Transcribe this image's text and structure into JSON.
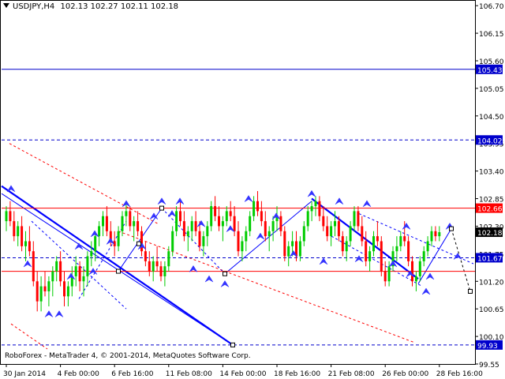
{
  "header": {
    "symbol": "USDJPY,H4",
    "open": "102.13",
    "high": "102.27",
    "low": "102.11",
    "close": "102.18"
  },
  "copyright": "RoboForex - MetaTrader 4, © 2001-2014, MetaQuotes Software Corp.",
  "colors": {
    "background": "#ffffff",
    "frame": "#000000",
    "bull_candle": "#00cc00",
    "bear_candle": "#ff0000",
    "level_line": "#0000cc",
    "resistance": "#ff0000",
    "label_blue": "#0000cc",
    "label_red": "#ff0000",
    "trend_channel": "#0000ff",
    "arrow_marker": "#3333ff"
  },
  "chart_data": {
    "type": "candlestick",
    "title": "USDJPY,H4",
    "ylim": [
      99.55,
      106.75
    ],
    "y_ticks": [
      "106.70",
      "106.15",
      "105.60",
      "105.05",
      "104.50",
      "103.95",
      "103.40",
      "102.85",
      "102.30",
      "101.75",
      "101.20",
      "100.65",
      "100.10",
      "99.55"
    ],
    "x_ticks": [
      "30 Jan 2014",
      "4 Feb 00:00",
      "6 Feb 16:00",
      "11 Feb 08:00",
      "14 Feb 00:00",
      "18 Feb 16:00",
      "21 Feb 08:00",
      "26 Feb 00:00",
      "28 Feb 16:00"
    ],
    "x_tick_index": [
      0,
      14,
      28,
      42,
      56,
      70,
      84,
      98,
      112
    ],
    "levels": [
      {
        "label": "105.43",
        "value": 105.43,
        "style": "solid",
        "color": "#0000cc",
        "label_bg": "#0000cc"
      },
      {
        "label": "104.02",
        "value": 104.02,
        "style": "dashed",
        "color": "#0000cc",
        "label_bg": "#0000cc"
      },
      {
        "label": "102.66",
        "value": 102.66,
        "style": "solid",
        "color": "#ff0000",
        "label_bg": "#ff0000"
      },
      {
        "label": "102.18",
        "value": 102.18,
        "style": "none",
        "color": "#000000",
        "label_bg": "#000000"
      },
      {
        "label": "101.67",
        "value": 101.67,
        "style": "dashed",
        "color": "#0000cc",
        "label_bg": "#0000cc"
      },
      {
        "label": "99.93",
        "value": 99.93,
        "style": "dashed",
        "color": "#0000cc",
        "label_bg": "#0000cc"
      }
    ],
    "resistance_line_2": 101.4,
    "candles": [
      [
        102.4,
        102.7,
        102.2,
        102.6
      ],
      [
        102.6,
        102.8,
        102.3,
        102.4
      ],
      [
        102.4,
        102.6,
        102.0,
        102.1
      ],
      [
        102.1,
        102.4,
        101.9,
        102.3
      ],
      [
        102.3,
        102.5,
        101.8,
        101.9
      ],
      [
        101.9,
        102.2,
        101.6,
        102.0
      ],
      [
        102.0,
        102.3,
        101.7,
        101.8
      ],
      [
        101.8,
        102.0,
        101.1,
        101.2
      ],
      [
        101.2,
        101.4,
        100.6,
        100.8
      ],
      [
        100.8,
        101.3,
        100.6,
        101.1
      ],
      [
        101.1,
        101.4,
        100.9,
        101.0
      ],
      [
        101.0,
        101.3,
        100.7,
        101.2
      ],
      [
        101.2,
        101.5,
        100.9,
        101.4
      ],
      [
        101.4,
        101.7,
        101.2,
        101.6
      ],
      [
        101.6,
        101.8,
        101.1,
        101.2
      ],
      [
        101.2,
        101.4,
        100.7,
        100.9
      ],
      [
        100.9,
        101.2,
        100.7,
        101.1
      ],
      [
        101.1,
        101.5,
        100.9,
        101.3
      ],
      [
        101.3,
        101.7,
        101.1,
        101.5
      ],
      [
        101.5,
        101.6,
        101.0,
        101.2
      ],
      [
        101.2,
        101.5,
        100.9,
        101.3
      ],
      [
        101.3,
        101.8,
        101.1,
        101.7
      ],
      [
        101.7,
        102.0,
        101.5,
        101.8
      ],
      [
        101.8,
        102.2,
        101.6,
        102.1
      ],
      [
        102.1,
        102.4,
        101.9,
        102.3
      ],
      [
        102.3,
        102.6,
        102.1,
        102.5
      ],
      [
        102.5,
        102.7,
        102.1,
        102.2
      ],
      [
        102.2,
        102.4,
        101.9,
        102.0
      ],
      [
        102.0,
        102.2,
        101.7,
        101.9
      ],
      [
        101.9,
        102.3,
        101.8,
        102.2
      ],
      [
        102.2,
        102.6,
        102.1,
        102.5
      ],
      [
        102.5,
        102.8,
        102.3,
        102.6
      ],
      [
        102.6,
        102.7,
        102.2,
        102.3
      ],
      [
        102.3,
        102.5,
        102.0,
        102.4
      ],
      [
        102.4,
        102.6,
        102.1,
        102.2
      ],
      [
        102.2,
        102.3,
        101.7,
        101.8
      ],
      [
        101.8,
        102.0,
        101.5,
        101.6
      ],
      [
        101.6,
        101.8,
        101.3,
        101.4
      ],
      [
        101.4,
        101.7,
        101.2,
        101.6
      ],
      [
        101.6,
        101.9,
        101.4,
        101.5
      ],
      [
        101.5,
        101.6,
        101.2,
        101.3
      ],
      [
        101.3,
        101.6,
        101.1,
        101.5
      ],
      [
        101.5,
        101.9,
        101.4,
        101.8
      ],
      [
        101.8,
        102.3,
        101.7,
        102.2
      ],
      [
        102.2,
        102.7,
        102.1,
        102.6
      ],
      [
        102.6,
        102.8,
        102.3,
        102.4
      ],
      [
        102.4,
        102.6,
        102.0,
        102.1
      ],
      [
        102.1,
        102.3,
        101.8,
        102.2
      ],
      [
        102.2,
        102.5,
        102.0,
        102.4
      ],
      [
        102.4,
        102.6,
        102.1,
        102.2
      ],
      [
        102.2,
        102.4,
        101.8,
        101.9
      ],
      [
        101.9,
        102.2,
        101.7,
        102.1
      ],
      [
        102.1,
        102.4,
        101.9,
        102.3
      ],
      [
        102.3,
        102.8,
        102.2,
        102.7
      ],
      [
        102.7,
        102.9,
        102.4,
        102.5
      ],
      [
        102.5,
        102.7,
        102.2,
        102.3
      ],
      [
        102.3,
        102.5,
        102.0,
        102.4
      ],
      [
        102.4,
        102.7,
        102.3,
        102.6
      ],
      [
        102.6,
        102.8,
        102.4,
        102.5
      ],
      [
        102.5,
        102.7,
        102.1,
        102.2
      ],
      [
        102.2,
        102.4,
        101.7,
        101.8
      ],
      [
        101.8,
        102.1,
        101.6,
        102.0
      ],
      [
        102.0,
        102.3,
        101.8,
        102.2
      ],
      [
        102.2,
        102.6,
        102.1,
        102.5
      ],
      [
        102.5,
        102.9,
        102.4,
        102.8
      ],
      [
        102.8,
        103.0,
        102.5,
        102.6
      ],
      [
        102.6,
        102.8,
        102.3,
        102.4
      ],
      [
        102.4,
        102.6,
        102.0,
        102.1
      ],
      [
        102.1,
        102.3,
        101.8,
        102.2
      ],
      [
        102.2,
        102.5,
        102.0,
        102.4
      ],
      [
        102.4,
        102.7,
        102.2,
        102.5
      ],
      [
        102.5,
        102.6,
        102.1,
        102.2
      ],
      [
        102.2,
        102.3,
        101.6,
        101.7
      ],
      [
        101.7,
        102.0,
        101.5,
        101.9
      ],
      [
        101.9,
        102.2,
        101.7,
        102.0
      ],
      [
        102.0,
        102.2,
        101.6,
        101.7
      ],
      [
        101.7,
        102.1,
        101.6,
        102.0
      ],
      [
        102.0,
        102.4,
        101.9,
        102.3
      ],
      [
        102.3,
        102.7,
        102.2,
        102.6
      ],
      [
        102.6,
        102.8,
        102.4,
        102.7
      ],
      [
        102.7,
        102.9,
        102.5,
        102.8
      ],
      [
        102.8,
        102.9,
        102.4,
        102.5
      ],
      [
        102.5,
        102.7,
        102.2,
        102.3
      ],
      [
        102.3,
        102.5,
        102.0,
        102.1
      ],
      [
        102.1,
        102.4,
        101.9,
        102.3
      ],
      [
        102.3,
        102.6,
        102.1,
        102.4
      ],
      [
        102.4,
        102.5,
        102.0,
        102.1
      ],
      [
        102.1,
        102.2,
        101.7,
        101.8
      ],
      [
        101.8,
        102.1,
        101.6,
        102.0
      ],
      [
        102.0,
        102.4,
        101.9,
        102.3
      ],
      [
        102.3,
        102.7,
        102.2,
        102.6
      ],
      [
        102.6,
        102.7,
        102.2,
        102.3
      ],
      [
        102.3,
        102.5,
        101.9,
        102.0
      ],
      [
        102.0,
        102.2,
        101.5,
        101.6
      ],
      [
        101.6,
        101.9,
        101.4,
        101.8
      ],
      [
        101.8,
        102.2,
        101.7,
        102.1
      ],
      [
        102.1,
        102.4,
        101.9,
        102.0
      ],
      [
        102.0,
        102.1,
        101.3,
        101.4
      ],
      [
        101.4,
        101.6,
        101.1,
        101.2
      ],
      [
        101.2,
        101.6,
        101.1,
        101.5
      ],
      [
        101.5,
        101.9,
        101.4,
        101.8
      ],
      [
        101.8,
        102.1,
        101.6,
        101.9
      ],
      [
        101.9,
        102.2,
        101.8,
        102.1
      ],
      [
        102.1,
        102.4,
        101.9,
        102.0
      ],
      [
        102.0,
        102.1,
        101.5,
        101.6
      ],
      [
        101.6,
        101.7,
        101.1,
        101.2
      ],
      [
        101.2,
        101.4,
        101.0,
        101.3
      ],
      [
        101.3,
        101.7,
        101.2,
        101.6
      ],
      [
        101.6,
        101.9,
        101.5,
        101.8
      ],
      [
        101.8,
        102.1,
        101.7,
        102.0
      ],
      [
        102.0,
        102.3,
        101.9,
        102.2
      ],
      [
        102.2,
        102.3,
        102.0,
        102.1
      ],
      [
        102.1,
        102.3,
        102.0,
        102.18
      ]
    ],
    "projection": [
      [
        109,
        102.2
      ],
      [
        111,
        101.8
      ],
      [
        113,
        101.0
      ]
    ]
  }
}
